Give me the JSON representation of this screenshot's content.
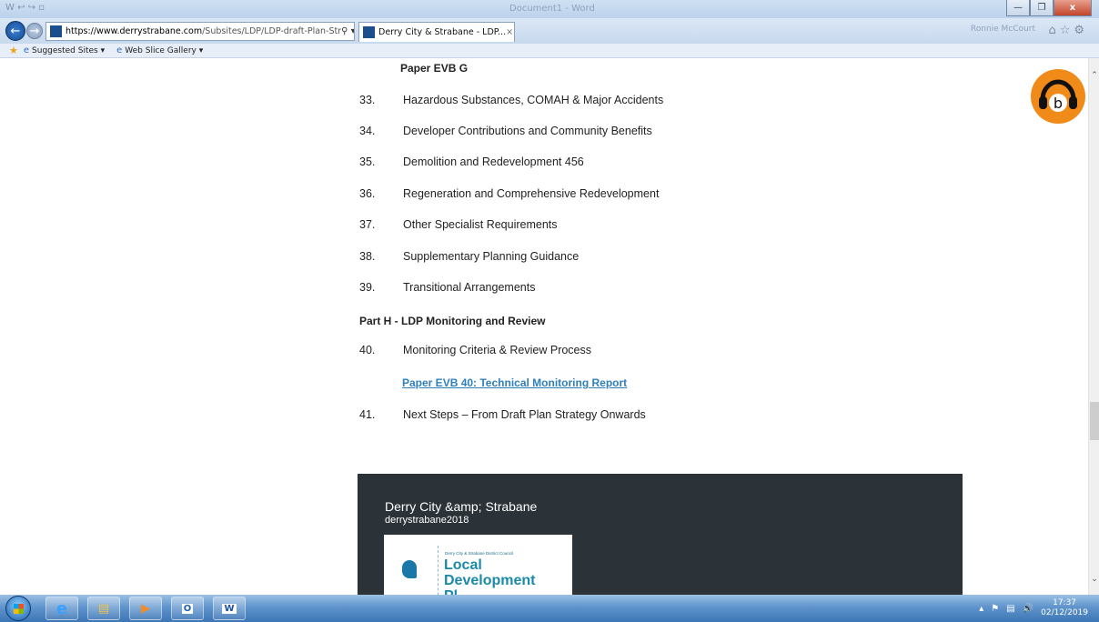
{
  "window": {
    "document_title": "Document1 - Word",
    "user_name": "Ronnie McCourt"
  },
  "browser": {
    "url_host": "https://www.derrystrabane.com",
    "url_path": "/Subsites/LDP/LDP-draft-Plan-Str",
    "tab_title": "Derry City & Strabane - LDP...",
    "favorites": [
      "Suggested Sites",
      "Web Slice Gallery"
    ]
  },
  "page": {
    "heading_top": "Paper EVB G",
    "items_a": [
      {
        "num": "33.",
        "text": "Hazardous Substances, COMAH & Major Accidents"
      },
      {
        "num": "34.",
        "text": "Developer Contributions and Community Benefits"
      },
      {
        "num": "35.",
        "text": "Demolition and Redevelopment 456"
      },
      {
        "num": "36.",
        "text": "Regeneration and Comprehensive Redevelopment"
      },
      {
        "num": "37.",
        "text": "Other Specialist Requirements"
      },
      {
        "num": "38.",
        "text": "Supplementary Planning Guidance"
      },
      {
        "num": "39.",
        "text": "Transitional Arrangements"
      }
    ],
    "part_h": "Part H - LDP Monitoring and Review",
    "item_40": {
      "num": "40.",
      "text": "Monitoring Criteria & Review Process"
    },
    "link_40": "Paper EVB 40: Technical Monitoring Report",
    "item_41": {
      "num": "41.",
      "text": "Next Steps – From Draft Plan Strategy Onwards"
    }
  },
  "footer": {
    "title": "Derry City &amp; Strabane",
    "handle": "derrystrabane2018",
    "card_council": "Derry City & Strabane District Council",
    "card_line1": "Local",
    "card_line2": "Development",
    "card_line3": "Pl"
  },
  "taskbar": {
    "time": "17:37",
    "date": "02/12/2019"
  },
  "colors": {
    "accent_link": "#2f7fbb",
    "footer_bg": "#2b3338",
    "audio_button": "#f08a18"
  }
}
